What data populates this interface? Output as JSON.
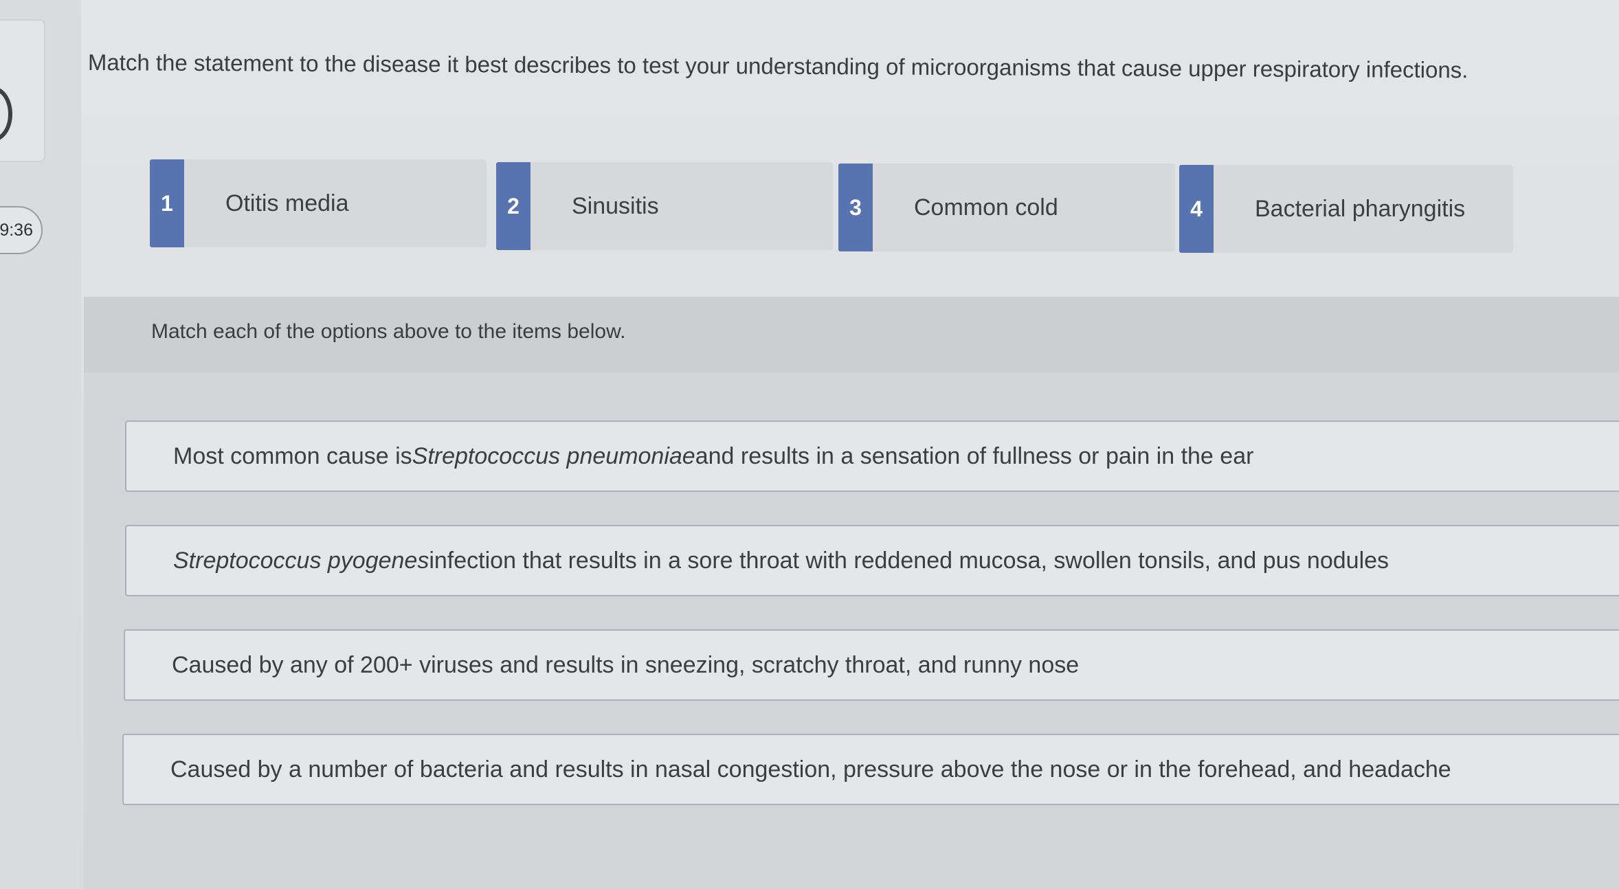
{
  "timer": {
    "text": "9:36"
  },
  "question": {
    "instruction": "Match the statement to the disease it best describes to test your understanding of microorganisms that cause upper respiratory infections."
  },
  "options": [
    {
      "number": "1",
      "label": "Otitis media"
    },
    {
      "number": "2",
      "label": "Sinusitis"
    },
    {
      "number": "3",
      "label": "Common cold"
    },
    {
      "number": "4",
      "label": "Bacterial pharyngitis"
    }
  ],
  "match_panel": {
    "instruction": "Match each of the options above to the items below.",
    "items": [
      {
        "pre": "Most common cause is ",
        "italic": "Streptococcus pneumoniae",
        "post": " and results in a sensation of fullness or pain in the ear"
      },
      {
        "pre": "",
        "italic": "Streptococcus pyogenes",
        "post": " infection that results in a sore throat with reddened mucosa, swollen tonsils, and pus nodules"
      },
      {
        "pre": "Caused by any of 200+ viruses and results in sneezing, scratchy throat, and runny nose",
        "italic": "",
        "post": ""
      },
      {
        "pre": "Caused by a number of bacteria and results in nasal congestion, pressure above the nose or in the forehead, and headache",
        "italic": "",
        "post": ""
      }
    ]
  }
}
